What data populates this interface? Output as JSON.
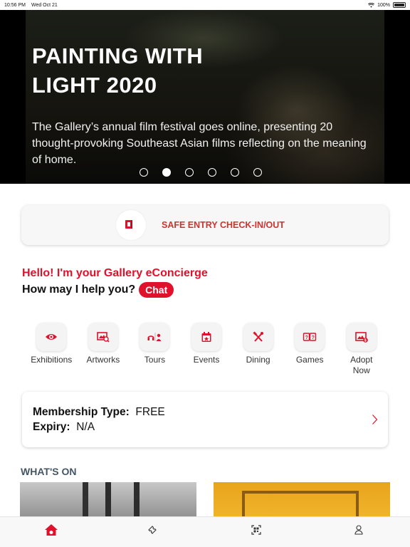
{
  "status_bar": {
    "time": "10:56 PM",
    "date": "Wed Oct 21",
    "battery": "100%"
  },
  "hero": {
    "title": "PAINTING WITH LIGHT 2020",
    "description": "The Gallery’s annual film festival goes online, presenting 20 thought-provoking Southeast Asian films reflecting on the meaning of home.",
    "slides": 6,
    "active_slide": 2
  },
  "safe_entry": {
    "label": "SAFE ENTRY CHECK-IN/OUT",
    "logo_text": "Gallery"
  },
  "concierge": {
    "line1": "Hello! I'm your Gallery eConcierge",
    "line2": "How may I help you?",
    "chat_label": "Chat"
  },
  "shortcuts": [
    {
      "label": "Exhibitions",
      "icon": "eye-icon"
    },
    {
      "label": "Artworks",
      "icon": "picture-search-icon"
    },
    {
      "label": "Tours",
      "icon": "audio-guide-icon"
    },
    {
      "label": "Events",
      "icon": "calendar-icon"
    },
    {
      "label": "Dining",
      "icon": "utensils-icon"
    },
    {
      "label": "Games",
      "icon": "game-cards-icon"
    },
    {
      "label": "Adopt Now",
      "icon": "adopt-picture-icon"
    }
  ],
  "membership": {
    "type_label": "Membership Type:",
    "type_value": "FREE",
    "expiry_label": "Expiry:",
    "expiry_value": "N/A"
  },
  "whats_on": {
    "title": "WHAT'S ON"
  },
  "tabbar": [
    {
      "name": "home",
      "icon": "home-icon",
      "active": true
    },
    {
      "name": "tickets",
      "icon": "ticket-icon",
      "active": false
    },
    {
      "name": "scan",
      "icon": "qr-scan-icon",
      "active": false
    },
    {
      "name": "profile",
      "icon": "user-icon",
      "active": false
    }
  ],
  "colors": {
    "accent": "#e0112b",
    "safe_entry": "#d0332e",
    "section_title": "#445566"
  }
}
